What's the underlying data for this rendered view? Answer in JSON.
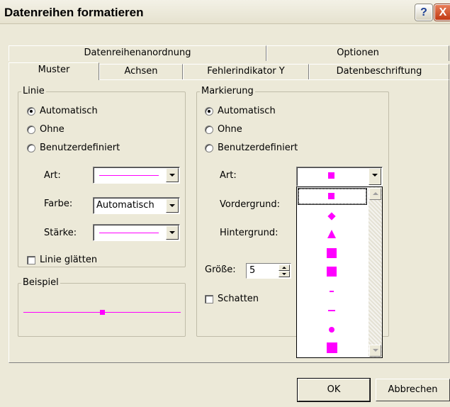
{
  "dialog": {
    "title": "Datenreihen formatieren",
    "help_glyph": "?",
    "close_glyph": "X"
  },
  "tabs": {
    "back_row": [
      "Datenreihenanordnung",
      "Optionen"
    ],
    "front_row": [
      "Muster",
      "Achsen",
      "Fehlerindikator Y",
      "Datenbeschriftung"
    ],
    "active": "Muster"
  },
  "linie": {
    "group_label": "Linie",
    "options": [
      "Automatisch",
      "Ohne",
      "Benutzerdefiniert"
    ],
    "selected": "Automatisch",
    "art_label": "Art:",
    "farbe_label": "Farbe:",
    "farbe_value": "Automatisch",
    "staerke_label": "Stärke:",
    "glaetten_label": "Linie glätten"
  },
  "beispiel": {
    "group_label": "Beispiel"
  },
  "markierung": {
    "group_label": "Markierung",
    "options": [
      "Automatisch",
      "Ohne",
      "Benutzerdefiniert"
    ],
    "selected": "Automatisch",
    "art_label": "Art:",
    "vordergrund_label": "Vordergrund:",
    "hintergrund_label": "Hintergrund:",
    "groesse_label": "Größe:",
    "groesse_value": "5",
    "schatten_label": "Schatten",
    "marker_list": [
      "square-marker-icon",
      "diamond-marker-icon",
      "triangle-marker-icon",
      "square-marker-icon",
      "square-marker-icon",
      "short-dash-marker-icon",
      "long-dash-marker-icon",
      "circle-marker-icon",
      "square-marker-icon"
    ]
  },
  "colors": {
    "marker": "#ff00ff",
    "line": "#ff00ff"
  },
  "buttons": {
    "ok": "OK",
    "cancel": "Abbrechen"
  }
}
